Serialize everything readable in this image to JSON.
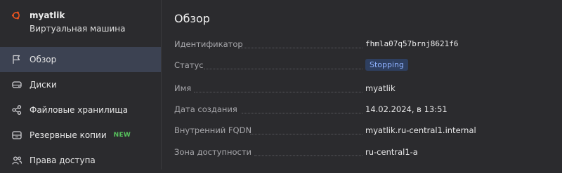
{
  "vm": {
    "name": "myatlik",
    "type": "Виртуальная машина"
  },
  "nav": {
    "items": [
      {
        "label": "Обзор",
        "icon": "flag-icon",
        "active": true
      },
      {
        "label": "Диски",
        "icon": "disk-icon"
      },
      {
        "label": "Файловые хранилища",
        "icon": "share-icon"
      },
      {
        "label": "Резервные копии",
        "icon": "backup-icon",
        "badge": "NEW"
      },
      {
        "label": "Права доступа",
        "icon": "users-icon"
      }
    ]
  },
  "main": {
    "title": "Обзор",
    "fields": [
      {
        "label": "Идентификатор",
        "value": "fhmla07q57brnj8621f6"
      },
      {
        "label": "Статус",
        "value": "Stopping"
      },
      {
        "label": "Имя",
        "value": "myatlik"
      },
      {
        "label": "Дата создания",
        "value": "14.02.2024, в 13:51"
      },
      {
        "label": "Внутренний FQDN",
        "value": "myatlik.ru-central1.internal"
      },
      {
        "label": "Зона доступности",
        "value": "ru-central1-a"
      }
    ]
  },
  "colors": {
    "background": "#2b2b2e",
    "active_nav": "#3c4252",
    "status_badge_bg": "#2e3f60",
    "status_badge_text": "#8fb2ff",
    "new_badge": "#57c25c",
    "brand_icon": "#e95420"
  }
}
